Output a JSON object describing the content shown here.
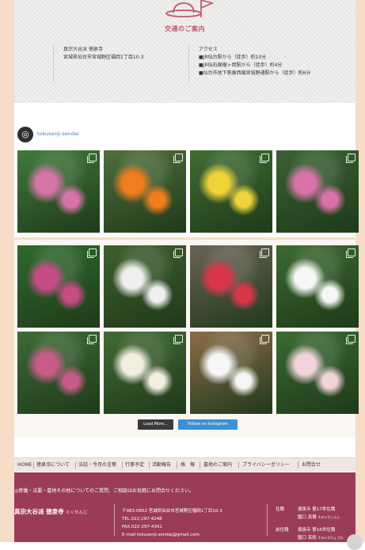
{
  "access": {
    "title": "交通のご案内",
    "temple_line": "真宗大谷派 徳泉寺",
    "address_line": "宮城県仙台市宮城野区福岡1丁目10-3",
    "heading": "アクセス",
    "route1": "■JR仙台駅から（徒歩）約10分",
    "route2": "■JR仙石線榴ヶ岡駅から（徒歩）約4分",
    "route3": "■仙台市地下鉄東西線宮城野通駅から（徒歩）約6分"
  },
  "instagram": {
    "handle": "tokusenji.sendai",
    "load_more": "Load More...",
    "follow": "Follow on Instagram"
  },
  "nav": {
    "items": [
      "HOME",
      "徳泉寺について",
      "法話・今月の言葉",
      "行事予定",
      "活動報告",
      "格　報",
      "墓地のご案内",
      "プライバシーポリシー",
      "お問合せ"
    ]
  },
  "footer": {
    "note": "◎葬儀・法要・墓地その他についてのご質問、ご相談はお気軽にお問合せください。",
    "name": "真宗大谷派 徳泉寺",
    "name_kana": "とくせんじ",
    "postal": "〒983-0852 宮城県仙台市宮城野区榴岡1丁目10-3",
    "tel": "TEL.022-297-4248",
    "fax": "FAX.022-297-4301",
    "email": "E-mail tokusenji.sendai@gmail.com",
    "role1_label": "住職",
    "role1_title": "徳泉寺 第17世住職",
    "role1_name": "園口 真爾",
    "role1_kana": "そのぐちしんじ",
    "role2_label": "前住職",
    "role2_title": "徳泉寺 第16世住職",
    "role2_name": "園口 亮和",
    "role2_kana": "そのぐちりょうわ"
  },
  "photos": [
    {
      "desc": "pink-hydrangea",
      "bg": "#3f7a3a",
      "accent": "#d774a7"
    },
    {
      "desc": "orange-lily",
      "bg": "#4f6f3c",
      "accent": "#f07d1e"
    },
    {
      "desc": "yellow-sedum",
      "bg": "#3f6d33",
      "accent": "#f0d23a"
    },
    {
      "desc": "pink-flowers",
      "bg": "#3a6233",
      "accent": "#d873a8"
    },
    {
      "desc": "pink-spirea",
      "bg": "#2f6a2d",
      "accent": "#c64c86"
    },
    {
      "desc": "white-spike",
      "bg": "#3f5f2e",
      "accent": "#efefef"
    },
    {
      "desc": "red-honeysuckle",
      "bg": "#6b6258",
      "accent": "#d8374a"
    },
    {
      "desc": "white-star-flower",
      "bg": "#3b6a30",
      "accent": "#f6f6f6"
    },
    {
      "desc": "pink-hanging-bells",
      "bg": "#3e6a35",
      "accent": "#c65c88"
    },
    {
      "desc": "white-cluster",
      "bg": "#416b33",
      "accent": "#f3eee2"
    },
    {
      "desc": "white-pink-pot",
      "bg": "#8d6c4a",
      "accent": "#f6f6f6"
    },
    {
      "desc": "pale-pink-peony",
      "bg": "#3a6a33",
      "accent": "#f2d3db"
    }
  ]
}
